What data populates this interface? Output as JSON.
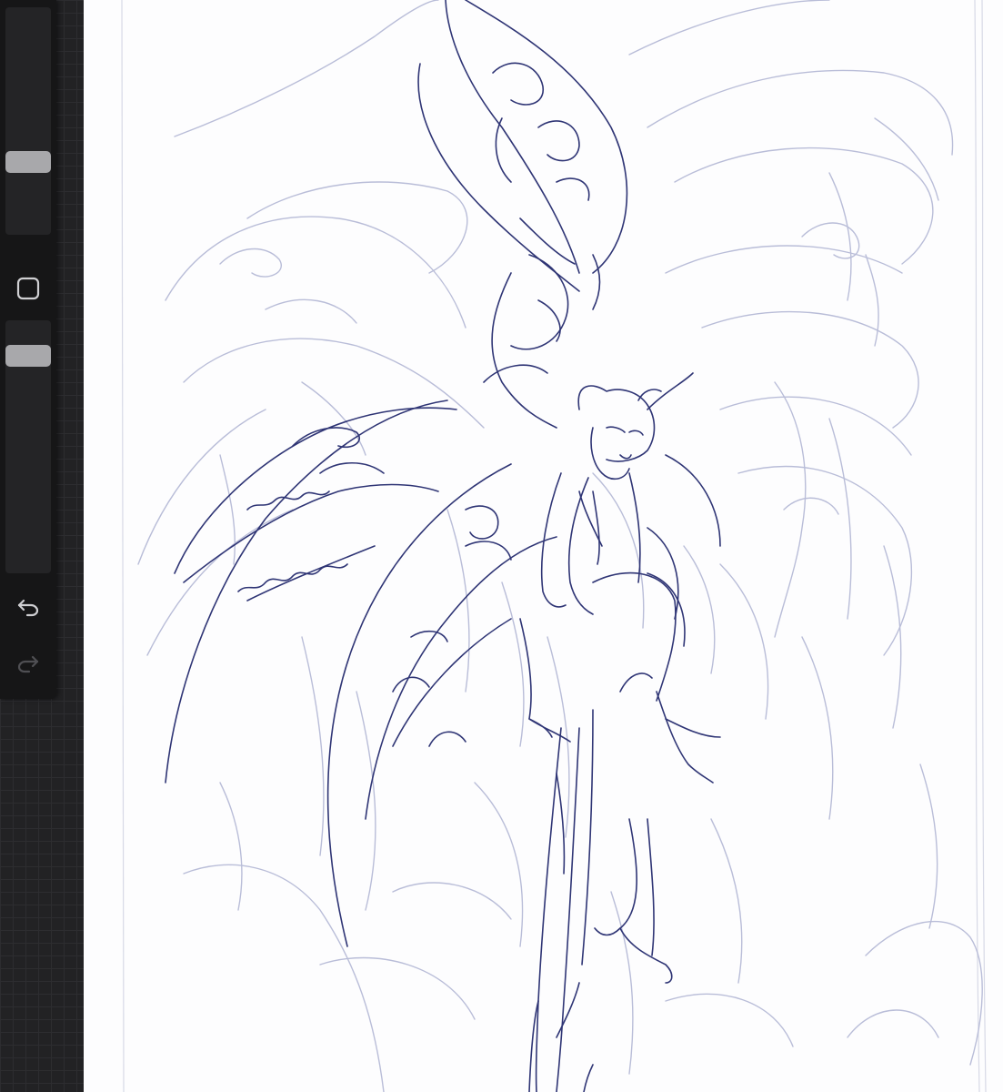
{
  "app": {
    "canvas_background": "#fdfdfe",
    "workspace_background": "#222224",
    "sidebar_background": "#161617",
    "sketch_color": "#2f3575",
    "construction_color": "#b9bdd8"
  },
  "sidebar": {
    "brush_size_slider": {
      "icon": "slider-handle"
    },
    "modify_button": {
      "icon": "square-outline-icon"
    },
    "brush_opacity_slider": {
      "icon": "slider-handle"
    },
    "undo_button": {
      "icon": "undo-icon",
      "enabled": true
    },
    "redo_button": {
      "icon": "redo-icon",
      "enabled": false
    }
  }
}
